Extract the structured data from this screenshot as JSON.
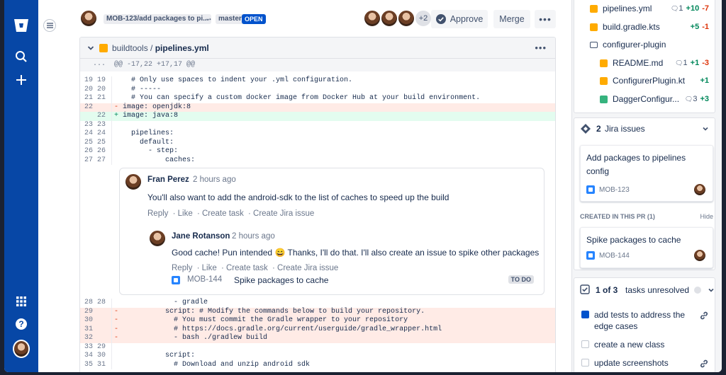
{
  "pr": {
    "source_branch": "MOB-123/add packages to pi...",
    "target_branch": "master",
    "status": "OPEN",
    "reviewers_more": "+2",
    "approve_label": "Approve",
    "merge_label": "Merge"
  },
  "file": {
    "dir": "buildtools / ",
    "name": "pipelines.yml",
    "hunk": "@@ -17,22 +17,17 @@",
    "hunk_dots": "...",
    "more": "..."
  },
  "code_top": [
    {
      "old": "19",
      "new": "19",
      "sign": "",
      "text": "  # Only use spaces to indent your .yml configuration."
    },
    {
      "old": "20",
      "new": "20",
      "sign": "",
      "text": "  # -----"
    },
    {
      "old": "21",
      "new": "21",
      "sign": "",
      "text": "  # You can specify a custom docker image from Docker Hub at your build environment."
    },
    {
      "old": "22",
      "new": "",
      "sign": "-",
      "text": "image: openjdk:8"
    },
    {
      "old": "",
      "new": "22",
      "sign": "+",
      "text": "image: java:8"
    },
    {
      "old": "23",
      "new": "23",
      "sign": "",
      "text": ""
    },
    {
      "old": "24",
      "new": "24",
      "sign": "",
      "text": "  pipelines:"
    },
    {
      "old": "25",
      "new": "25",
      "sign": "",
      "text": "    default:"
    },
    {
      "old": "26",
      "new": "26",
      "sign": "",
      "text": "      - step:"
    },
    {
      "old": "27",
      "new": "27",
      "sign": "",
      "text": "          caches:"
    }
  ],
  "code_bottom": [
    {
      "old": "28",
      "new": "28",
      "sign": "",
      "text": "            - gradle"
    },
    {
      "old": "29",
      "new": "",
      "sign": "-",
      "text": "          script: # Modify the commands below to build your repository."
    },
    {
      "old": "30",
      "new": "",
      "sign": "-",
      "text": "            # You must commit the Gradle wrapper to your repository"
    },
    {
      "old": "31",
      "new": "",
      "sign": "-",
      "text": "            # https://docs.gradle.org/current/userguide/gradle_wrapper.html"
    },
    {
      "old": "32",
      "new": "",
      "sign": "-",
      "text": "            - bash ./gradlew build"
    },
    {
      "old": "33",
      "new": "29",
      "sign": "",
      "text": ""
    },
    {
      "old": "34",
      "new": "30",
      "sign": "",
      "text": "          script:"
    },
    {
      "old": "35",
      "new": "31",
      "sign": "",
      "text": "            # Download and unzip android sdk"
    }
  ],
  "comments": [
    {
      "author": "Fran Perez",
      "time": "2 hours ago",
      "text": "You'll also want to add the android-sdk to the list of caches to speed up the build",
      "actions": [
        "Reply",
        "Like",
        "Create task",
        "Create Jira issue"
      ]
    },
    {
      "author": "Jane Rotanson",
      "time": "2 hours ago",
      "text": "Good cache! Pun intended 😄 Thanks, I'll do that. I'll also create an issue to spike other packages",
      "actions": [
        "Reply",
        "Like",
        "Create task",
        "Create Jira issue"
      ]
    }
  ],
  "linked_issue": {
    "key": "MOB-144",
    "title": "Spike packages to cache",
    "status": "TO DO"
  },
  "files": [
    {
      "name": "pipelines.yml",
      "comments": "1",
      "plus": "+10",
      "minus": "-7",
      "kind": "file",
      "indent": 0
    },
    {
      "name": "build.gradle.kts",
      "comments": "",
      "plus": "+5",
      "minus": "-1",
      "kind": "file",
      "indent": 0
    },
    {
      "name": "configurer-plugin",
      "comments": "",
      "plus": "",
      "minus": "",
      "kind": "folder",
      "indent": 0
    },
    {
      "name": "README.md",
      "comments": "1",
      "plus": "+1",
      "minus": "-3",
      "kind": "file",
      "indent": 1
    },
    {
      "name": "ConfigurerPlugin.kt",
      "comments": "",
      "plus": "+1",
      "minus": "",
      "kind": "file",
      "indent": 1
    },
    {
      "name": "DaggerConfigur...",
      "comments": "3",
      "plus": "+3",
      "minus": "",
      "kind": "added",
      "indent": 1
    }
  ],
  "jira": {
    "count": "2",
    "label": "Jira issues",
    "items": [
      {
        "title_line1": "Add packages to pipelines",
        "title_line2": "config",
        "key": "MOB-123"
      }
    ],
    "created_label": "CREATED IN THIS PR (1)",
    "hide_label": "Hide",
    "created_items": [
      {
        "title": "Spike packages to cache",
        "key": "MOB-144"
      }
    ]
  },
  "tasks": {
    "count": "1 of 3",
    "label": "tasks unresolved",
    "items": [
      {
        "text": "add tests to address the edge cases",
        "done": true
      },
      {
        "text": "create a new class",
        "done": false
      },
      {
        "text": "update screenshots",
        "done": false
      }
    ]
  }
}
